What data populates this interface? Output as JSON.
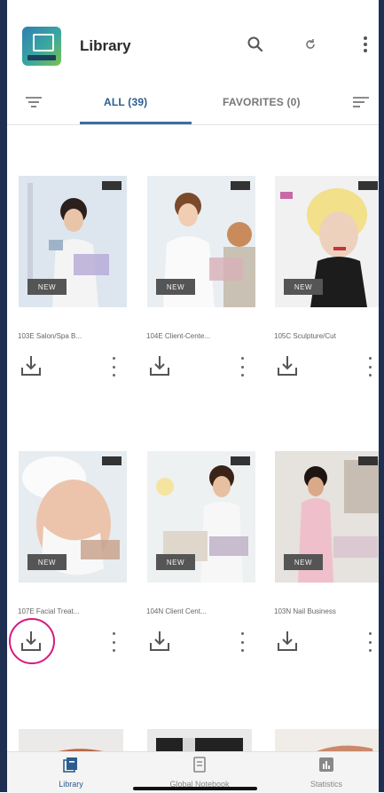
{
  "app": {
    "title": "Library"
  },
  "header_icons": [
    "search-icon",
    "refresh-icon",
    "more-vert-icon"
  ],
  "tabs": [
    {
      "label": "ALL (39)",
      "active": true
    },
    {
      "label": "FAVORITES (0)",
      "active": false
    }
  ],
  "toolbar_icons": [
    "filter-icon",
    "sort-icon"
  ],
  "library": {
    "items": [
      {
        "title": "103E Salon/Spa B...",
        "badge": "NEW"
      },
      {
        "title": "104E Client-Cente...",
        "badge": "NEW"
      },
      {
        "title": "105C Sculpture/Cut",
        "badge": "NEW"
      },
      {
        "title": "107E Facial Treat...",
        "badge": "NEW"
      },
      {
        "title": "104N Client Cent...",
        "badge": "NEW"
      },
      {
        "title": "103N Nail Business",
        "badge": "NEW"
      }
    ]
  },
  "bottom_nav": [
    {
      "label": "Library",
      "active": true
    },
    {
      "label": "Global Notebook",
      "active": false
    },
    {
      "label": "Statistics",
      "active": false
    }
  ],
  "colors": {
    "accent": "#2d5d8f",
    "highlight": "#d61a7e",
    "frame": "#1f2f52"
  }
}
